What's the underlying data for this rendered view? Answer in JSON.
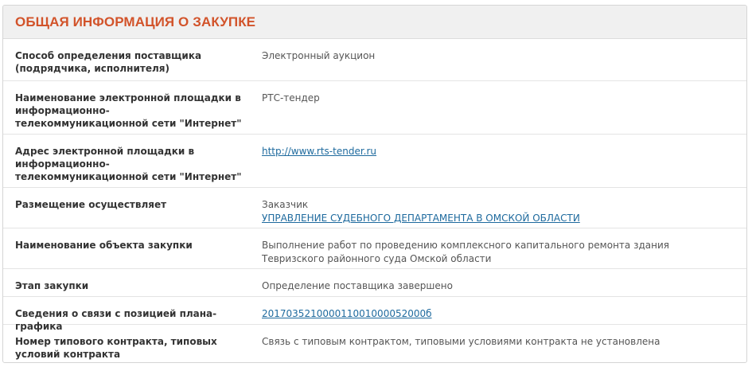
{
  "section": {
    "title": "ОБЩАЯ ИНФОРМАЦИЯ О ЗАКУПКЕ"
  },
  "rows": [
    {
      "label": "Способ определения поставщика (подрядчика, исполнителя)",
      "value": "Электронный аукцион"
    },
    {
      "label": "Наименование электронной площадки в информационно-телекоммуникационной сети \"Интернет\"",
      "value": "РТС-тендер"
    },
    {
      "label": "Адрес электронной площадки в информационно-телекоммуникационной сети \"Интернет\"",
      "link": "http://www.rts-tender.ru"
    },
    {
      "label": "Размещение осуществляет",
      "value": "Заказчик",
      "link": "УПРАВЛЕНИЕ СУДЕБНОГО ДЕПАРТАМЕНТА В ОМСКОЙ ОБЛАСТИ"
    },
    {
      "label": "Наименование объекта закупки",
      "value": "Выполнение работ по проведению комплексного капитального ремонта здания Тевризского районного суда Омской области"
    },
    {
      "label": "Этап закупки",
      "value": "Определение поставщика завершено"
    },
    {
      "label": "Сведения о связи с позицией плана-графика",
      "link": "201703521000011001000052000б"
    },
    {
      "label": "Номер типового контракта, типовых условий контракта",
      "value": "Связь с типовым контрактом, типовыми условиями контракта не установлена"
    }
  ],
  "colors": {
    "title": "#d2532a",
    "link": "#1e6a9e",
    "header_bg": "#f0f0f0"
  }
}
